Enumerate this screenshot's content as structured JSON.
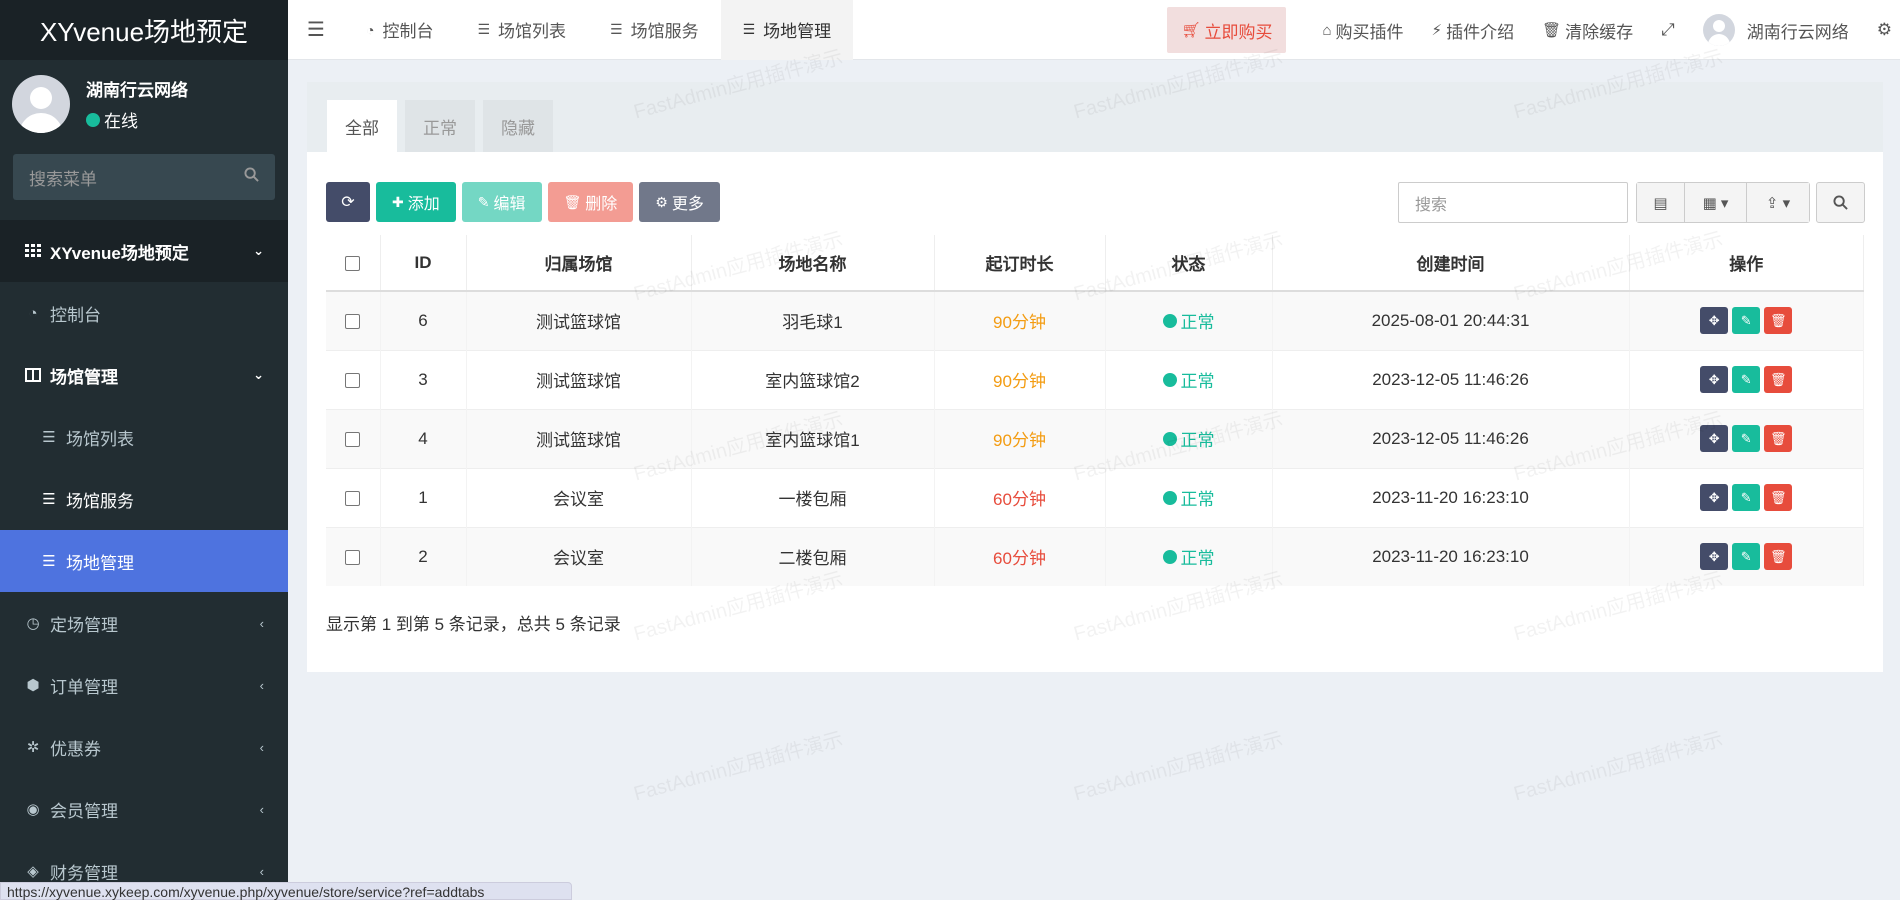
{
  "app": {
    "logo": "XYvenue场地预定",
    "user_name": "湖南行云网络",
    "user_status": "在线",
    "search_placeholder": "搜索菜单"
  },
  "sidebar": {
    "items": [
      {
        "label": "XYvenue场地预定",
        "icon": "grid-icon"
      },
      {
        "label": "控制台",
        "icon": "dashboard-icon"
      },
      {
        "label": "场馆管理",
        "icon": "columns-icon"
      },
      {
        "label": "场馆列表",
        "icon": "list-icon"
      },
      {
        "label": "场馆服务",
        "icon": "list-icon"
      },
      {
        "label": "场地管理",
        "icon": "list-icon"
      },
      {
        "label": "定场管理",
        "icon": "clock-icon"
      },
      {
        "label": "订单管理",
        "icon": "cube-icon"
      },
      {
        "label": "优惠券",
        "icon": "ticket-icon"
      },
      {
        "label": "会员管理",
        "icon": "user-icon"
      },
      {
        "label": "财务管理",
        "icon": "money-icon"
      }
    ]
  },
  "navbar": {
    "tabs": [
      "控制台",
      "场馆列表",
      "场馆服务",
      "场地管理"
    ],
    "buy": "立即购买",
    "buy_plugin": "购买插件",
    "plugin_intro": "插件介绍",
    "clear_cache": "清除缓存",
    "user_name": "湖南行云网络"
  },
  "page": {
    "tabs": [
      "全部",
      "正常",
      "隐藏"
    ],
    "buttons": {
      "add": "添加",
      "edit": "编辑",
      "delete": "删除",
      "more": "更多"
    },
    "search_placeholder": "搜索",
    "columns": [
      "ID",
      "归属场馆",
      "场地名称",
      "起订时长",
      "状态",
      "创建时间",
      "操作"
    ],
    "rows": [
      {
        "id": "6",
        "venue": "测试篮球馆",
        "name": "羽毛球1",
        "duration": "90分钟",
        "status": "正常",
        "created": "2025-08-01 20:44:31"
      },
      {
        "id": "3",
        "venue": "测试篮球馆",
        "name": "室内篮球馆2",
        "duration": "90分钟",
        "status": "正常",
        "created": "2023-12-05 11:46:26"
      },
      {
        "id": "4",
        "venue": "测试篮球馆",
        "name": "室内篮球馆1",
        "duration": "90分钟",
        "status": "正常",
        "created": "2023-12-05 11:46:26"
      },
      {
        "id": "1",
        "venue": "会议室",
        "name": "一楼包厢",
        "duration": "60分钟",
        "status": "正常",
        "created": "2023-11-20 16:23:10"
      },
      {
        "id": "2",
        "venue": "会议室",
        "name": "二楼包厢",
        "duration": "60分钟",
        "status": "正常",
        "created": "2023-11-20 16:23:10"
      }
    ],
    "summary": "显示第 1 到第 5 条记录，总共 5 条记录"
  },
  "statusbar_url": "https://xyvenue.xykeep.com/xyvenue.php/xyvenue/store/service?ref=addtabs",
  "watermark": "FastAdmin应用插件演示",
  "colors": {
    "sidebar_bg": "#222d32",
    "active": "#4e73df",
    "success": "#18bc9c",
    "danger": "#e74c3c",
    "warning": "#f39c12",
    "dark": "#444c69"
  }
}
